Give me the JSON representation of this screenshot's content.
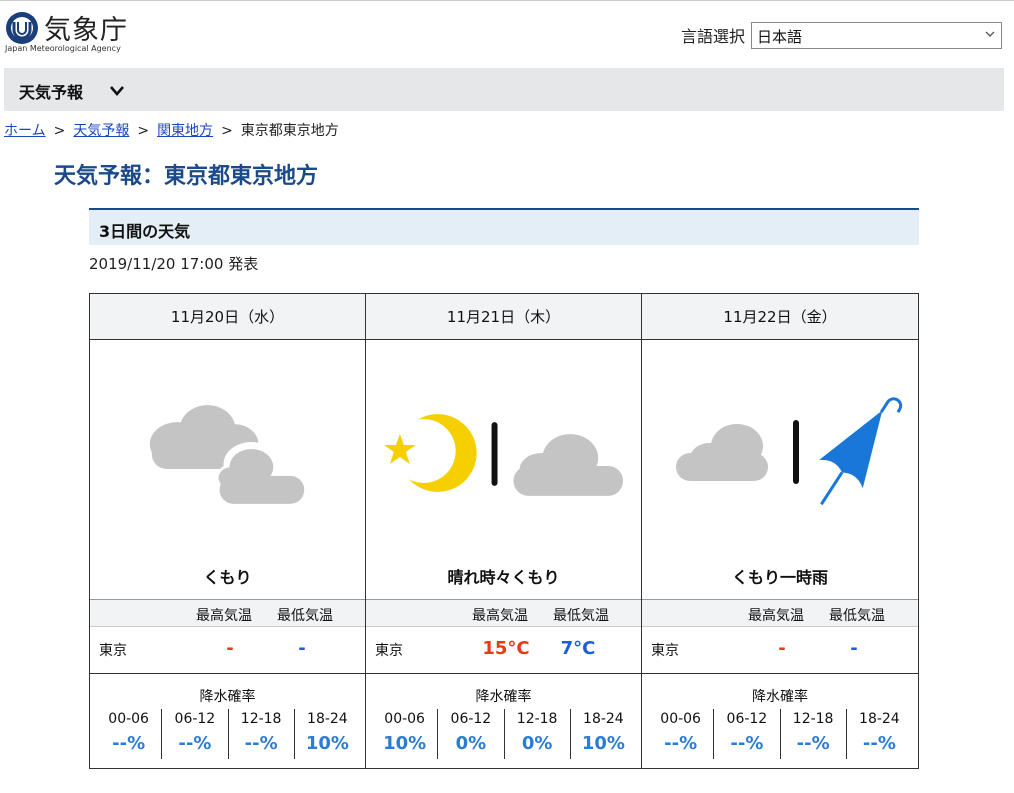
{
  "header": {
    "logo_jp": "気象庁",
    "logo_en": "Japan Meteorological Agency",
    "lang_label": "言語選択",
    "lang_value": "日本語"
  },
  "nav": {
    "label": "天気予報"
  },
  "breadcrumb": [
    {
      "label": "ホーム",
      "link": true
    },
    {
      "label": "天気予報",
      "link": true
    },
    {
      "label": "関東地方",
      "link": true
    },
    {
      "label": "東京都東京地方",
      "link": false
    }
  ],
  "breadcrumb_sep": ">",
  "page_title": "天気予報：東京都東京地方",
  "section_title": "3日間の天気",
  "issued": "2019/11/20 17:00 発表",
  "table": {
    "hi_label": "最高気温",
    "lo_label": "最低気温",
    "pop_label": "降水確率",
    "times": [
      "00-06",
      "06-12",
      "12-18",
      "18-24"
    ]
  },
  "days": [
    {
      "date": "11月20日（水）",
      "weather": "くもり",
      "icon": "cloudy-icon",
      "city": "東京",
      "hi": "-",
      "lo": "-",
      "pop": [
        "--%",
        "--%",
        "--%",
        "10%"
      ]
    },
    {
      "date": "11月21日（木）",
      "weather": "晴れ時々くもり",
      "icon": "clear-night-then-cloudy-icon",
      "city": "東京",
      "hi": "15°C",
      "lo": "7°C",
      "pop": [
        "10%",
        "0%",
        "0%",
        "10%"
      ]
    },
    {
      "date": "11月22日（金）",
      "weather": "くもり一時雨",
      "icon": "cloudy-then-rain-icon",
      "city": "東京",
      "hi": "-",
      "lo": "-",
      "pop": [
        "--%",
        "--%",
        "--%",
        "--%"
      ]
    }
  ],
  "colors": {
    "title_blue": "#1b4a8a",
    "hi_red": "#e8391a",
    "lo_blue": "#1d5fd6",
    "pop_blue": "#2a7cd4",
    "cloud_gray": "#c4c4c4",
    "moon_yellow": "#f5cf00",
    "umbrella_blue": "#1877d8"
  }
}
